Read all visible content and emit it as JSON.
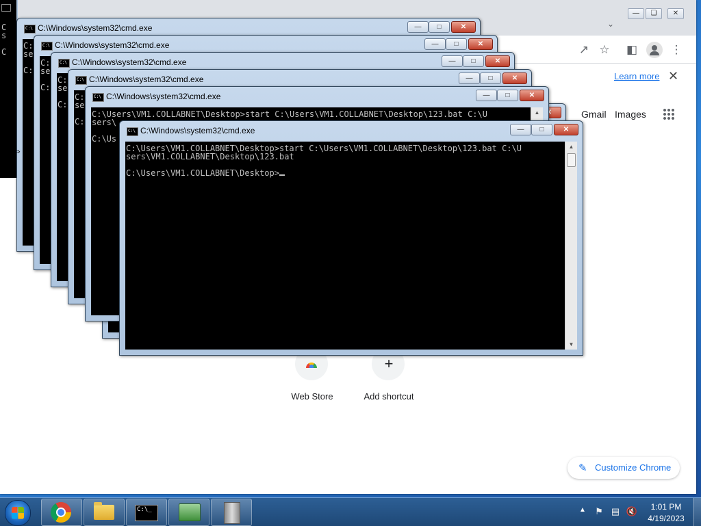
{
  "chrome": {
    "learn_more": "Learn more",
    "gmail": "Gmail",
    "images": "Images",
    "shortcuts": [
      {
        "label": "Web Store"
      },
      {
        "label": "Add shortcut"
      }
    ],
    "customize": "Customize Chrome"
  },
  "cmd_windows": [
    {
      "title": "C:\\Windows\\system32\\cmd.exe",
      "lines": "C:\nse\n\nC:"
    },
    {
      "title": "C:\\Windows\\system32\\cmd.exe",
      "lines": "C:\nse\n\nC:"
    },
    {
      "title": "C:\\Windows\\system32\\cmd.exe",
      "lines": "C:\nse\n\nC:"
    },
    {
      "title": "C:\\Windows\\system32\\cmd.exe",
      "lines": "C:\nse\n\nC:"
    },
    {
      "title": "C:\\Windows\\system32\\cmd.exe",
      "lines": "C:\\Users\\VM1.COLLABNET\\Desktop>start C:\\Users\\VM1.COLLABNET\\Desktop\\123.bat C:\\U\nsers\\\n\nC:\\Us"
    },
    {
      "title": "C:\\Windows\\system32\\cmd.exe",
      "line1": "C:\\Users\\VM1.COLLABNET\\Desktop>start C:\\Users\\VM1.COLLABNET\\Desktop\\123.bat C:\\U",
      "line2": "sers\\VM1.COLLABNET\\Desktop\\123.bat",
      "prompt": "C:\\Users\\VM1.COLLABNET\\Desktop>"
    }
  ],
  "taskbar": {
    "items": [
      {
        "name": "chrome",
        "icon": "chrome-icon"
      },
      {
        "name": "explorer",
        "icon": "folder-icon"
      },
      {
        "name": "cmd",
        "icon": "cmd-icon"
      },
      {
        "name": "network",
        "icon": "network-icon"
      },
      {
        "name": "server",
        "icon": "server-icon"
      }
    ],
    "time": "1:01 PM",
    "date": "4/19/2023"
  }
}
